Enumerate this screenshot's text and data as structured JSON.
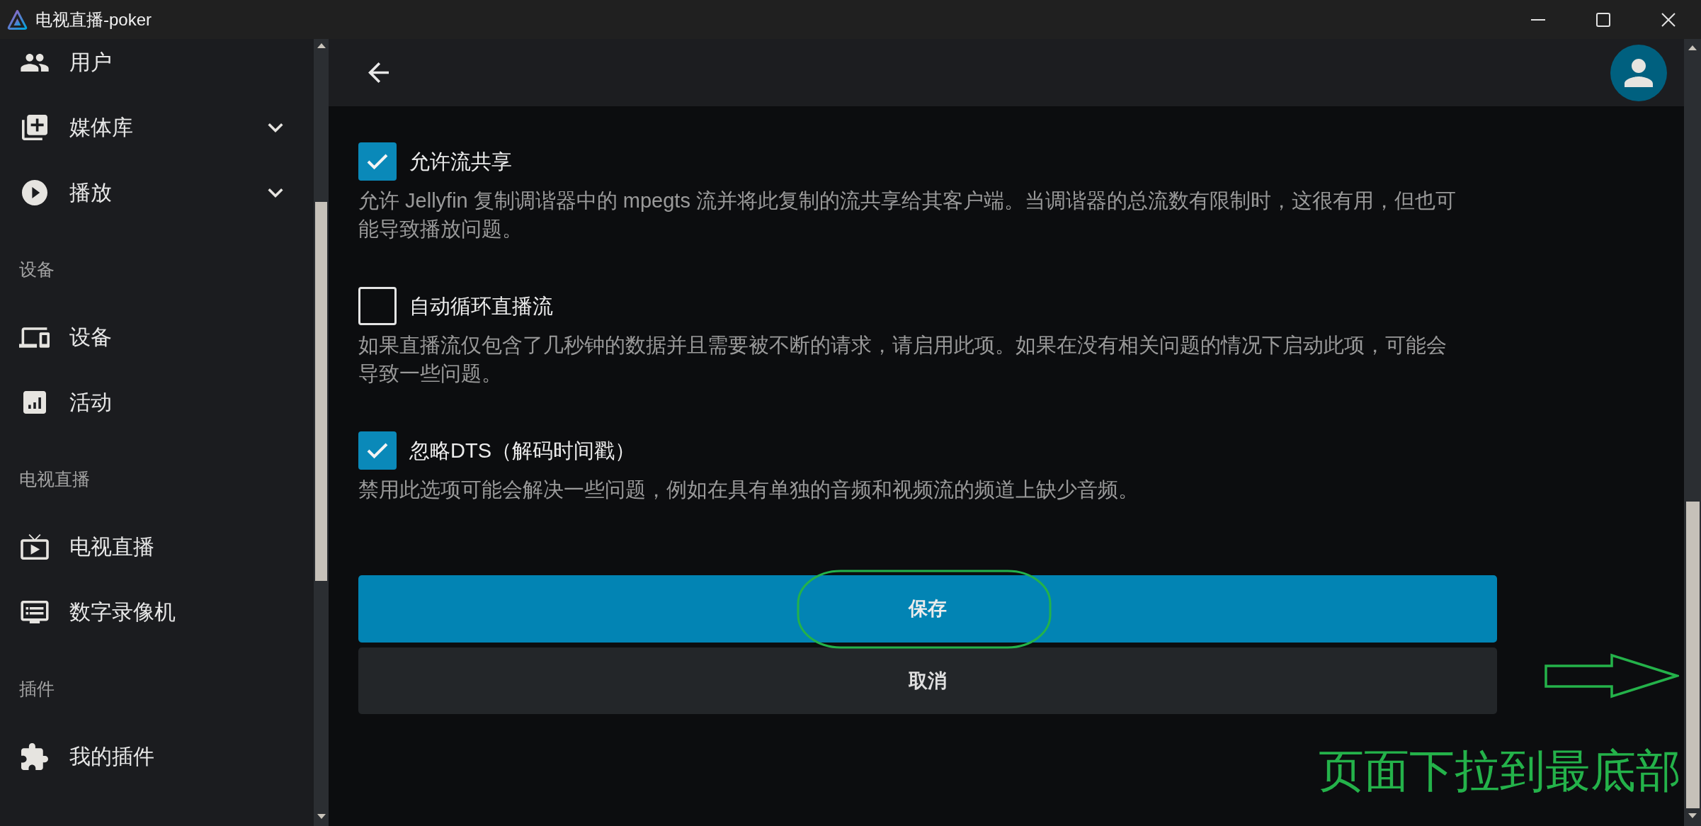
{
  "window": {
    "title": "电视直播-poker"
  },
  "sidebar": {
    "sections": [
      {
        "items": [
          {
            "kind": "link",
            "label": "用户"
          },
          {
            "kind": "group",
            "label": "媒体库",
            "expanded": false
          },
          {
            "kind": "group",
            "label": "播放",
            "expanded": false
          }
        ]
      },
      {
        "title": "设备",
        "items": [
          {
            "kind": "link",
            "label": "设备"
          },
          {
            "kind": "link",
            "label": "活动"
          }
        ]
      },
      {
        "title": "电视直播",
        "items": [
          {
            "kind": "link",
            "label": "电视直播"
          },
          {
            "kind": "link",
            "label": "数字录像机"
          }
        ]
      },
      {
        "title": "插件",
        "items": [
          {
            "kind": "link",
            "label": "我的插件"
          }
        ]
      }
    ]
  },
  "settings": [
    {
      "label": "允许流共享",
      "checked": true,
      "description": "允许 Jellyfin 复制调谐器中的 mpegts 流并将此复制的流共享给其客户端。当调谐器的总流数有限制时，这很有用，但也可能导致播放问题。"
    },
    {
      "label": "自动循环直播流",
      "checked": false,
      "description": "如果直播流仅包含了几秒钟的数据并且需要被不断的请求，请启用此项。如果在没有相关问题的情况下启动此项，可能会导致一些问题。"
    },
    {
      "label": "忽略DTS（解码时间戳）",
      "checked": true,
      "description": "禁用此选项可能会解决一些问题，例如在具有单独的音频和视频流的频道上缺少音频。"
    }
  ],
  "buttons": [
    {
      "kind": "primary",
      "label": "保存"
    },
    {
      "kind": "secondary",
      "label": "取消"
    }
  ],
  "annotation": {
    "text": "页面下拉到最底部"
  }
}
